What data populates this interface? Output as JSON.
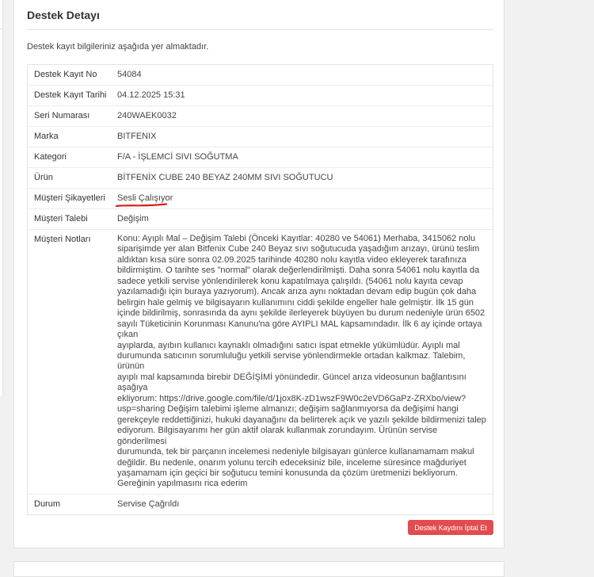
{
  "card": {
    "title": "Destek Detayı",
    "intro": "Destek kayıt bilgileriniz aşağıda yer almaktadır."
  },
  "details": {
    "record_no_label": "Destek Kayıt No",
    "record_no": "54084",
    "record_date_label": "Destek Kayıt Tarihi",
    "record_date": "04.12.2025 15:31",
    "serial_label": "Seri Numarası",
    "serial": "240WAEK0032",
    "brand_label": "Marka",
    "brand": "BITFENIX",
    "category_label": "Kategori",
    "category": "F/A - İŞLEMCİ SIVI SOĞUTMA",
    "product_label": "Ürün",
    "product": "BİTFENİX CUBE 240 BEYAZ 240MM SIVI SOĞUTUCU",
    "complaint_label": "Müşteri Şikayetleri",
    "complaint": "Sesli Çalışıyor",
    "request_label": "Müşteri Talebi",
    "request": "Değişim",
    "notes_label": "Müşteri Notları",
    "notes_lines": [
      "Konu: Ayıplı Mal – Değişim Talebi (Önceki Kayıtlar: 40280 ve 54061) Merhaba, 3415062 nolu",
      "siparişimde yer alan Bitfenix Cube 240 Beyaz sıvı soğutucuda yaşadığım arızayı, ürünü teslim",
      "aldıktan kısa süre sonra 02.09.2025 tarihinde 40280 nolu kayıtla video ekleyerek tarafınıza",
      "bildirmiştim. O tarihte ses \"normal\" olarak değerlendirilmişti. Daha sonra 54061 nolu kayıtla da",
      "sadece yetkili servise yönlendirilerek konu kapatılmaya çalışıldı. (54061 nolu kayıta cevap",
      "yazılamadığı için buraya yazıyorum). Ancak arıza aynı noktadan devam edip bugün çok daha",
      "belirgin hale gelmiş ve bilgisayarın kullanımını ciddi şekilde engeller hale gelmiştir. İlk 15 gün",
      "içinde bildirilmiş, sonrasında da aynı şekilde ilerleyerek büyüyen bu durum nedeniyle ürün 6502",
      "sayılı Tüketicinin Korunması Kanunu'na göre AYIPLI MAL kapsamındadır. İlk 6 ay içinde ortaya çıkan",
      "ayıplarda, ayıbın kullanıcı kaynaklı olmadığını satıcı ispat etmekle yükümlüdür. Ayıplı mal",
      "durumunda satıcının sorumluluğu yetkili servise yönlendirmekle ortadan kalkmaz. Talebim, ürünün",
      "ayıplı mal kapsamında birebir DEĞİŞİMİ yönündedir. Güncel arıza videosunun bağlantısını aşağıya",
      "ekliyorum: https://drive.google.com/file/d/1jox8K-zD1wszF9W0c2eVD6GaPz-ZRXbo/view?",
      "usp=sharing Değişim talebimi işleme almanızı; değişim sağlanmıyorsa da değişimi hangi",
      "gerekçeyle reddettiğinizi, hukuki dayanağını da belirterek açık ve yazılı şekilde bildirmenizi talep",
      "ediyorum. Bilgisayarımı her gün aktif olarak kullanmak zorundayım. Ürünün servise gönderilmesi",
      "durumunda, tek bir parçanın incelemesi nedeniyle bilgisayarı günlerce kullanamamam makul",
      "değildir. Bu nedenle, onarım yolunu tercih edeceksiniz bile, inceleme süresince mağduriyet",
      "yaşamamam için geçici bir soğutucu temini konusunda da çözüm üretmenizi bekliyorum.",
      "Gereğinin yapılmasını rica ederim"
    ],
    "status_label": "Durum",
    "status": "Servise Çağrıldı"
  },
  "actions": {
    "cancel_label": "Destek Kaydını İptal Et"
  },
  "colors": {
    "cancel_button": "#e34b4f",
    "highlight_underline": "#d42020"
  }
}
